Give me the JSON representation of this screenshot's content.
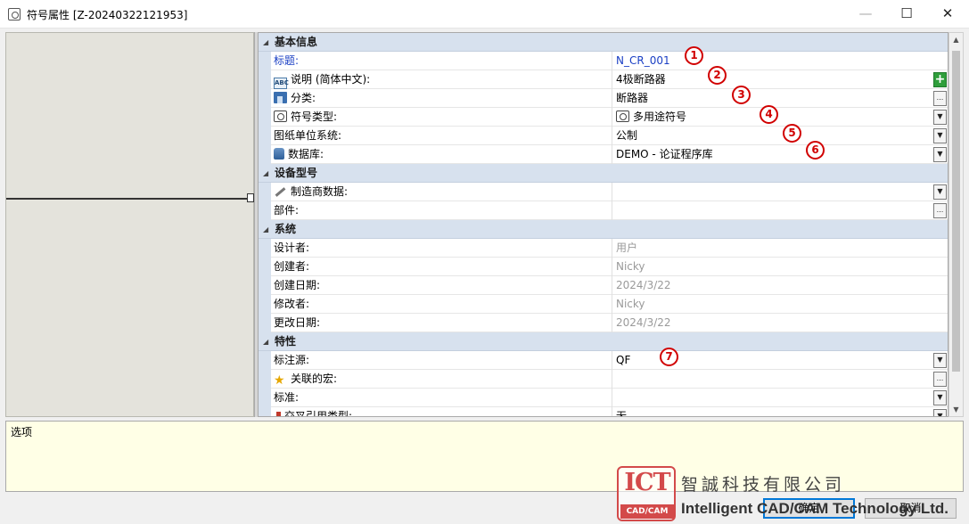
{
  "window": {
    "title": "符号属性 [Z-20240322121953]",
    "min_glyph": "—",
    "max_glyph": "☐",
    "close_glyph": "✕"
  },
  "categories": [
    {
      "label": "基本信息",
      "rows": [
        {
          "name": "标题:",
          "value": "N_CR_001",
          "icon": "",
          "button": "",
          "name_style": "link",
          "value_style": "link"
        },
        {
          "name": "说明 (简体中文):",
          "value": "4极断路器",
          "icon": "text-icon",
          "button": "plus",
          "name_style": "",
          "value_style": ""
        },
        {
          "name": "分类:",
          "value": "断路器",
          "icon": "category-icon",
          "button": "ellipsis",
          "name_style": "",
          "value_style": ""
        },
        {
          "name": "符号类型:",
          "value": "多用途符号",
          "icon": "symbol-icon",
          "value_icon": "symbol-icon",
          "button": "dropdown",
          "name_style": "",
          "value_style": ""
        },
        {
          "name": "图纸单位系统:",
          "value": "公制",
          "icon": "",
          "button": "dropdown",
          "name_style": "",
          "value_style": ""
        },
        {
          "name": "数据库:",
          "value": "DEMO - 论证程序库",
          "icon": "database-icon",
          "button": "dropdown",
          "name_style": "",
          "value_style": ""
        }
      ]
    },
    {
      "label": "设备型号",
      "rows": [
        {
          "name": "制造商数据:",
          "value": "",
          "icon": "wrench-icon",
          "button": "dropdown",
          "name_style": "",
          "value_style": ""
        },
        {
          "name": "部件:",
          "value": "",
          "icon": "",
          "button": "ellipsis",
          "name_style": "",
          "value_style": ""
        }
      ]
    },
    {
      "label": "系统",
      "rows": [
        {
          "name": "设计者:",
          "value": "用户",
          "icon": "",
          "button": "",
          "name_style": "",
          "value_style": "dim"
        },
        {
          "name": "创建者:",
          "value": "Nicky",
          "icon": "",
          "button": "",
          "name_style": "",
          "value_style": "dim"
        },
        {
          "name": "创建日期:",
          "value": "2024/3/22",
          "icon": "",
          "button": "",
          "name_style": "",
          "value_style": "dim"
        },
        {
          "name": "修改者:",
          "value": "Nicky",
          "icon": "",
          "button": "",
          "name_style": "",
          "value_style": "dim"
        },
        {
          "name": "更改日期:",
          "value": "2024/3/22",
          "icon": "",
          "button": "",
          "name_style": "",
          "value_style": "dim"
        }
      ]
    },
    {
      "label": "特性",
      "rows": [
        {
          "name": "标注源:",
          "value": "QF",
          "icon": "",
          "button": "dropdown",
          "name_style": "",
          "value_style": ""
        },
        {
          "name": "关联的宏:",
          "value": "",
          "icon": "star-icon",
          "button": "ellipsis",
          "name_style": "",
          "value_style": ""
        },
        {
          "name": "标准:",
          "value": "",
          "icon": "",
          "button": "dropdown",
          "name_style": "",
          "value_style": ""
        },
        {
          "name": "交叉引用类型:",
          "value": "无",
          "icon": "red-marker-icon",
          "button": "dropdown",
          "name_style": "",
          "value_style": ""
        }
      ]
    }
  ],
  "description_pane": {
    "title": "选项"
  },
  "buttons": {
    "ok": "确定",
    "cancel": "取消"
  },
  "markers": [
    "1",
    "2",
    "3",
    "4",
    "5",
    "6",
    "7"
  ],
  "watermark": {
    "logo_text": "ICT",
    "logo_sub": "CAD/CAM",
    "company_cn": "智誠科技有限公司",
    "company_en": "Intelligent CAD/CAM Technology Ltd."
  },
  "colors": {
    "category_bg": "#d7e1ee",
    "link": "#1a3fc4",
    "dim": "#9a9a9a",
    "marker": "#d10000",
    "desc_bg": "#ffffe6"
  }
}
